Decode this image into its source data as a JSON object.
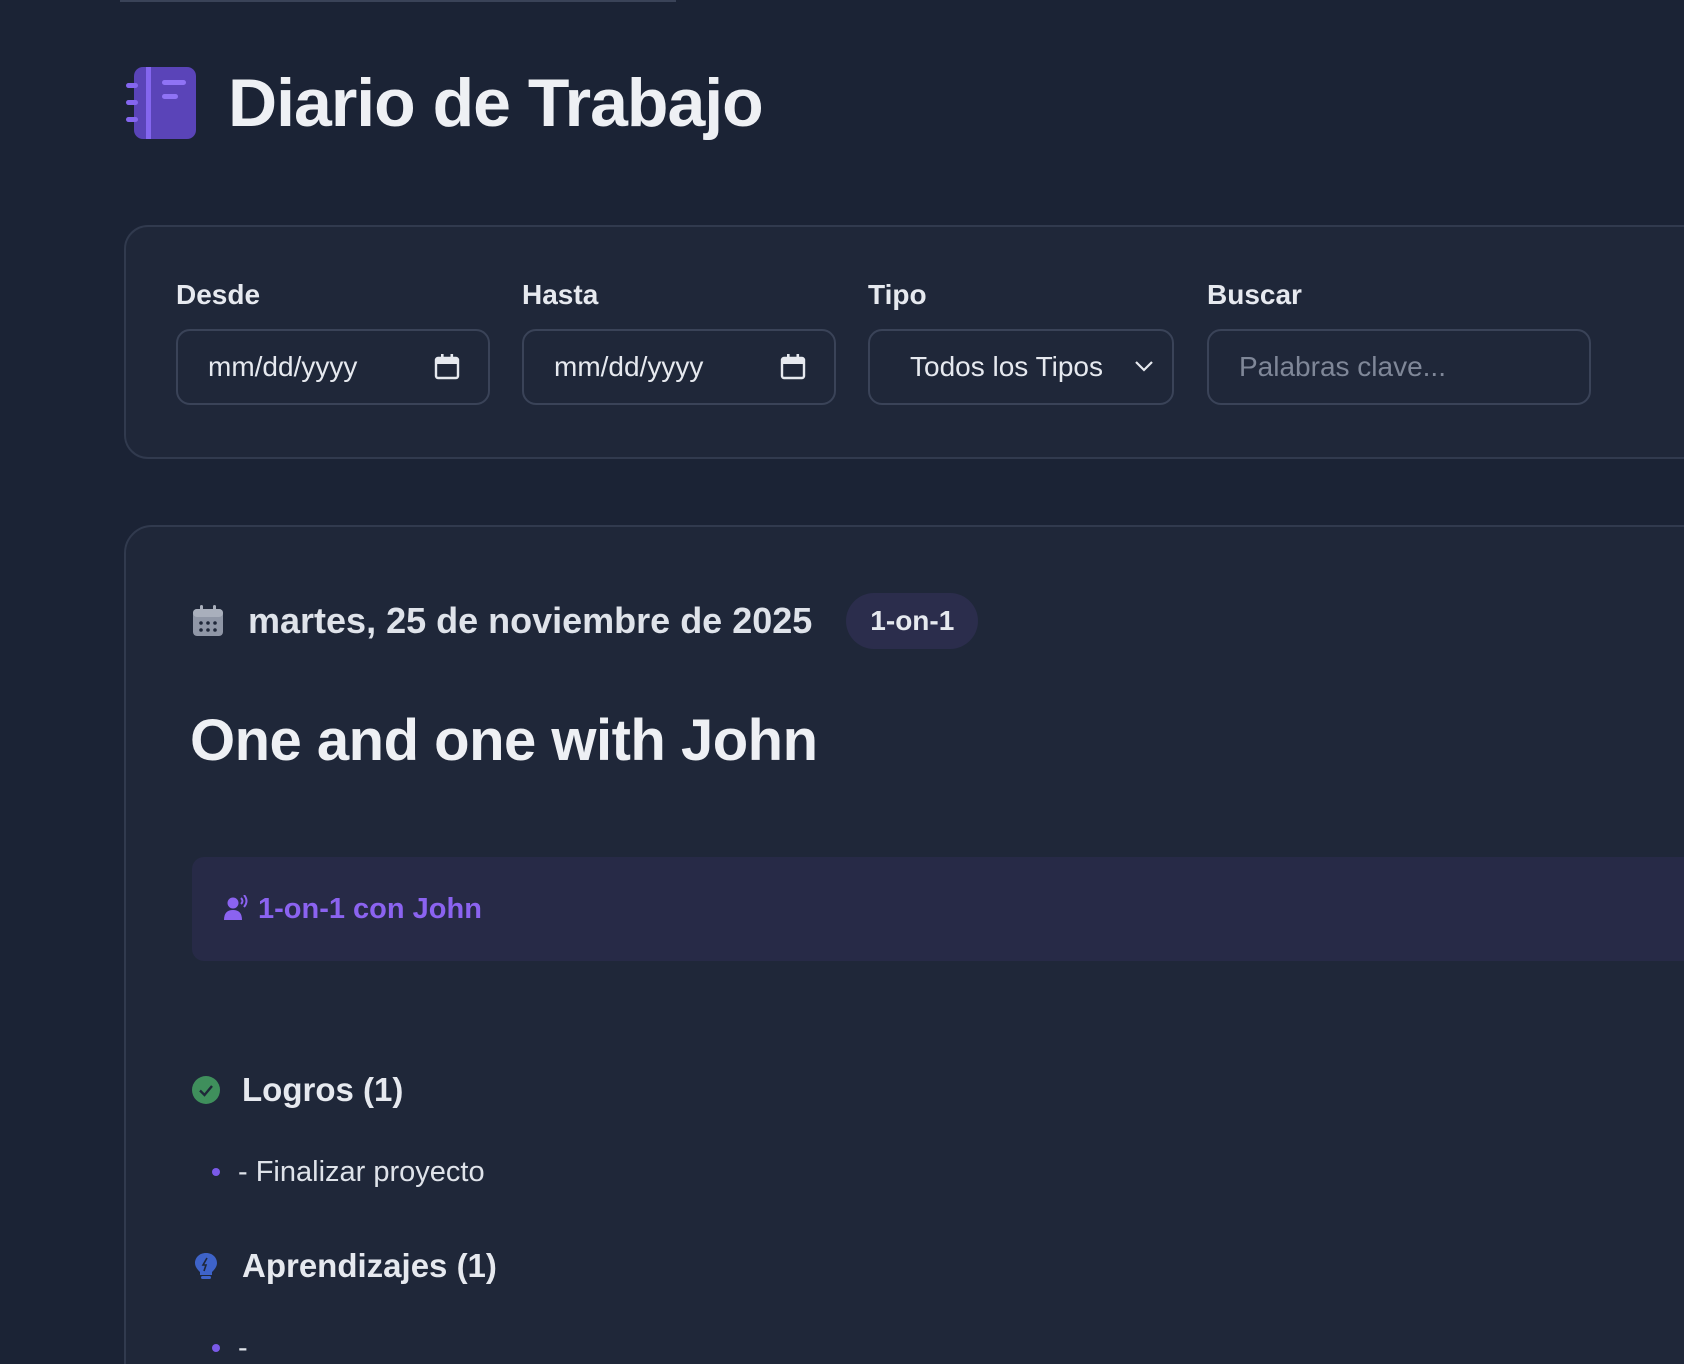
{
  "header": {
    "title": "Diario de Trabajo",
    "logo_icon": "notebook-icon"
  },
  "filters": {
    "from": {
      "label": "Desde",
      "placeholder": "mm/dd/yyyy"
    },
    "to": {
      "label": "Hasta",
      "placeholder": "mm/dd/yyyy"
    },
    "type": {
      "label": "Tipo",
      "selected": "Todos los Tipos"
    },
    "search": {
      "label": "Buscar",
      "placeholder": "Palabras clave..."
    }
  },
  "entry": {
    "date": "martes, 25 de noviembre de 2025",
    "badge": "1-on-1",
    "title": "One and one with John",
    "meeting_label": "1-on-1 con John",
    "sections": [
      {
        "icon": "check-circle-icon",
        "title": "Logros (1)",
        "items": [
          "- Finalizar proyecto"
        ]
      },
      {
        "icon": "lightbulb-icon",
        "title": "Aprendizajes (1)",
        "items": [
          "-"
        ]
      }
    ]
  },
  "colors": {
    "background": "#1b2335",
    "card": "#1f2739",
    "accent": "#8b63f0",
    "success": "#3f8f5c",
    "badge_bg": "#2b2d4c"
  }
}
